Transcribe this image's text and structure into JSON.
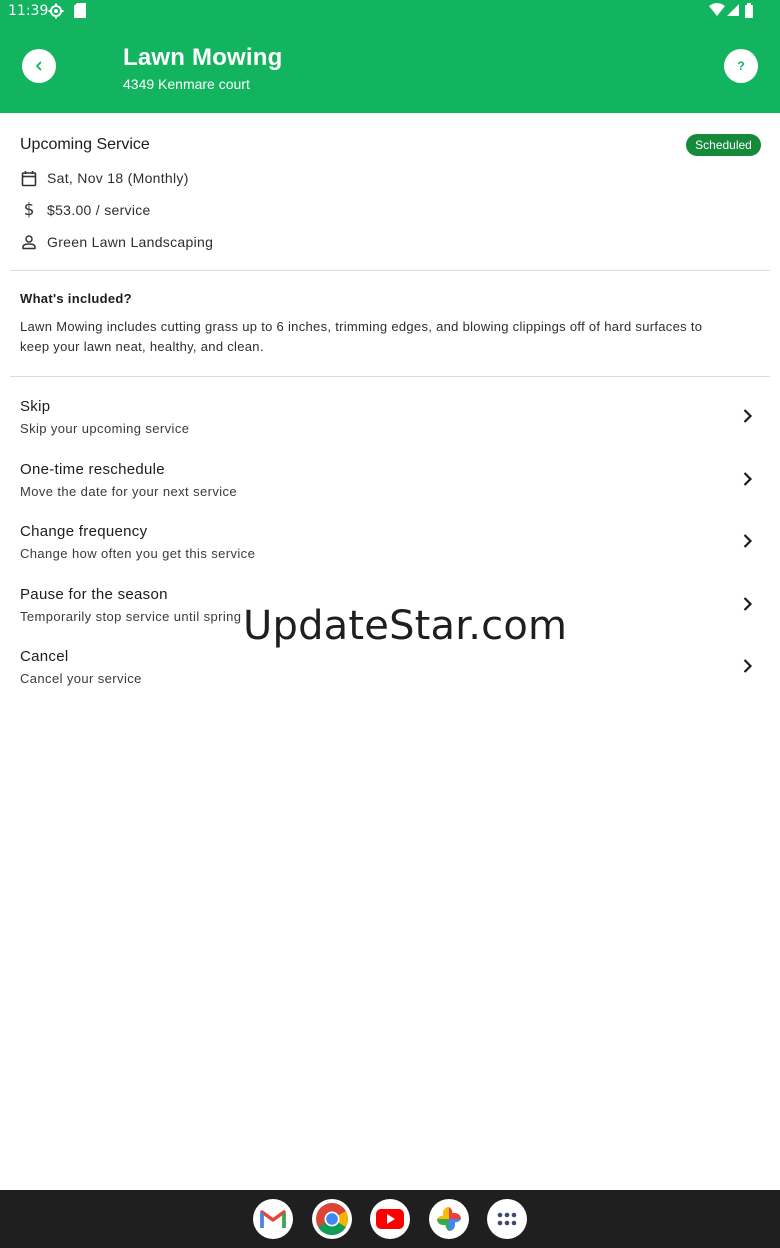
{
  "status_bar": {
    "time": "11:39"
  },
  "header": {
    "title": "Lawn Mowing",
    "subtitle": "4349 Kenmare court",
    "back_icon": "chevron-left-icon",
    "help_label": "?"
  },
  "upcoming": {
    "title": "Upcoming Service",
    "badge": "Scheduled",
    "date": "Sat, Nov 18 (Monthly)",
    "price": "$53.00 / service",
    "provider": "Green Lawn Landscaping"
  },
  "included": {
    "title": "What's included?",
    "body": "Lawn Mowing includes cutting grass up to 6 inches, trimming edges, and blowing clippings off of hard surfaces to keep your lawn neat, healthy, and clean."
  },
  "options": [
    {
      "title": "Skip",
      "subtitle": "Skip your upcoming service"
    },
    {
      "title": "One-time reschedule",
      "subtitle": "Move the date for your next service"
    },
    {
      "title": "Change frequency",
      "subtitle": "Change how often you get this service"
    },
    {
      "title": "Pause for the season",
      "subtitle": "Temporarily stop service until spring"
    },
    {
      "title": "Cancel",
      "subtitle": "Cancel your service"
    }
  ],
  "watermark": "UpdateStar.com",
  "dock": [
    "gmail-icon",
    "chrome-icon",
    "youtube-icon",
    "photos-icon",
    "app-drawer-icon"
  ],
  "colors": {
    "header_green": "#13b45f",
    "badge_green": "#148a3a"
  }
}
